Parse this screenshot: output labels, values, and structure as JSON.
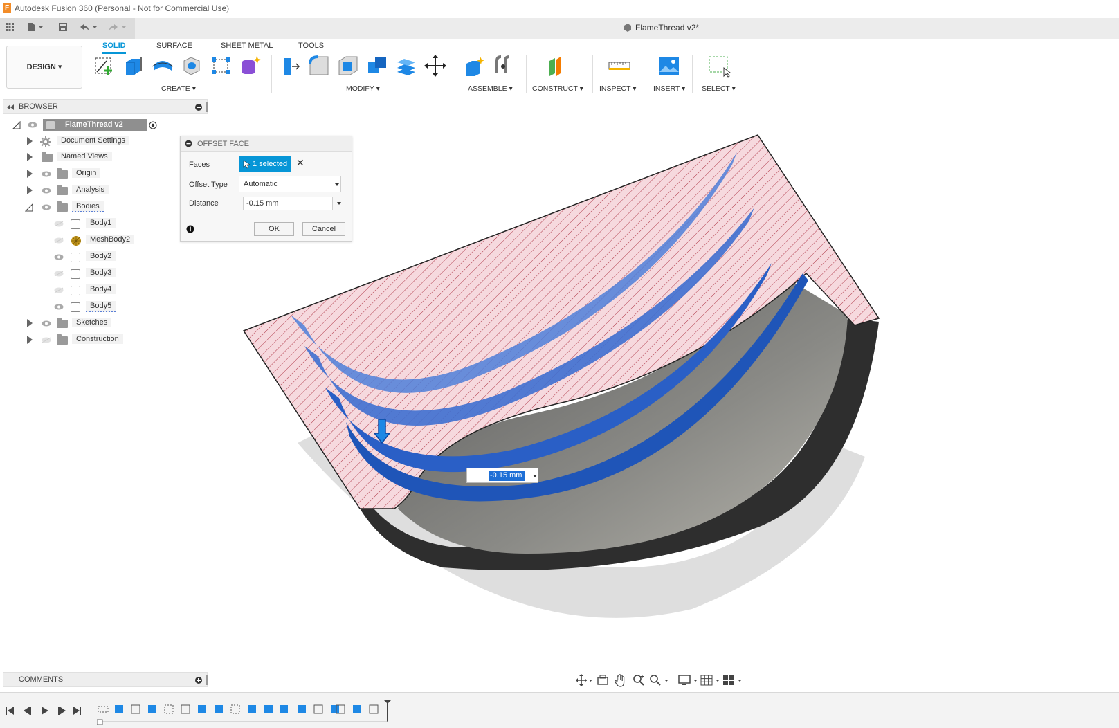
{
  "app": {
    "title": "Autodesk Fusion 360 (Personal - Not for Commercial Use)",
    "document_tab": "FlameThread v2*"
  },
  "ribbon": {
    "workspace": "DESIGN",
    "tabs": [
      "SOLID",
      "SURFACE",
      "SHEET METAL",
      "TOOLS"
    ],
    "active_tab": "SOLID",
    "groups": {
      "create": "CREATE",
      "modify": "MODIFY",
      "assemble": "ASSEMBLE",
      "construct": "CONSTRUCT",
      "inspect": "INSPECT",
      "insert": "INSERT",
      "select": "SELECT"
    }
  },
  "browser": {
    "header": "BROWSER",
    "root": "FlameThread v2",
    "items": {
      "document_settings": "Document Settings",
      "named_views": "Named Views",
      "origin": "Origin",
      "analysis": "Analysis",
      "bodies": "Bodies",
      "body1": "Body1",
      "meshbody2": "MeshBody2",
      "body2": "Body2",
      "body3": "Body3",
      "body4": "Body4",
      "body5": "Body5",
      "sketches": "Sketches",
      "construction": "Construction"
    }
  },
  "dialog": {
    "title": "OFFSET FACE",
    "faces_label": "Faces",
    "faces_value": "1 selected",
    "offset_type_label": "Offset Type",
    "offset_type_value": "Automatic",
    "distance_label": "Distance",
    "distance_value": "-0.15 mm",
    "ok": "OK",
    "cancel": "Cancel"
  },
  "canvas": {
    "inline_distance": "-0.15 mm"
  },
  "comments": {
    "header": "COMMENTS"
  },
  "colors": {
    "accent": "#0696d7",
    "hatch_fill": "#f6d9de",
    "hatch_line": "#b03a4a",
    "selected_face": "#2a64c8",
    "body_gray": "#6e6e6e"
  }
}
